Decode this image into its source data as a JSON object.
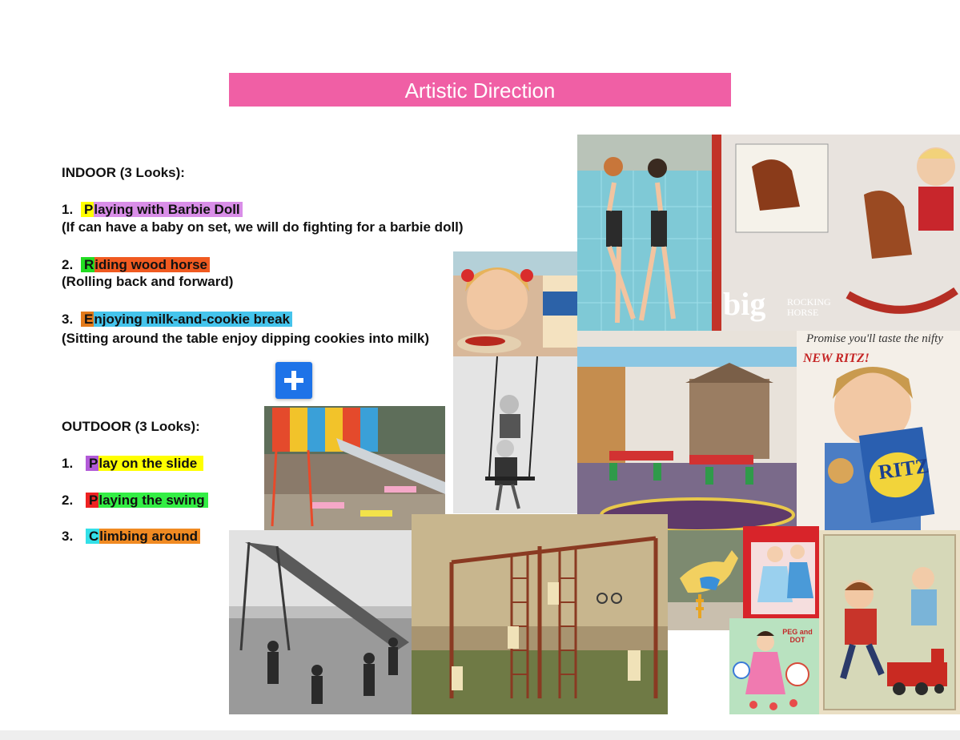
{
  "title": "Artistic Direction",
  "indoor": {
    "heading": "INDOOR (3 Looks):",
    "items": [
      {
        "num": "1.",
        "first": "P",
        "rest": "laying with Barbie Doll",
        "first_color": "#ffff00",
        "rest_color": "#d98ee8",
        "note": "(If can have a baby on set, we will do fighting for a barbie doll)"
      },
      {
        "num": "2.",
        "first": "R",
        "rest": "iding wood horse",
        "first_color": "#22dd22",
        "rest_color": "#f05a20",
        "note": "(Rolling back and forward)"
      },
      {
        "num": "3.",
        "first": "E",
        "rest": "njoying milk-and-cookie break",
        "first_color": "#e37a1a",
        "rest_color": "#45c4ec",
        "note": "(Sitting around the table enjoy dipping cookies into milk)"
      }
    ]
  },
  "outdoor": {
    "heading": "OUTDOOR (3 Looks):",
    "items": [
      {
        "num": "1.",
        "first": "P",
        "rest": "lay on the slide",
        "first_color": "#b25ad8",
        "rest_color": "#ffff00"
      },
      {
        "num": "2.",
        "first": "P",
        "rest": "laying the swing",
        "first_color": "#ee2222",
        "rest_color": "#33ee44"
      },
      {
        "num": "3.",
        "first": "C",
        "rest": "limbing around",
        "first_color": "#33e0e8",
        "rest_color": "#f08a22"
      }
    ]
  },
  "photos": {
    "big_logo": "big",
    "rocking_horse": "ROCKING HORSE",
    "ritz_slogan": "Promise you'll taste the nifty",
    "new_ritz": "NEW RITZ!",
    "ritz": "RITZ",
    "peg_dot": "PEG and DOT"
  },
  "colors": {
    "banner": "#f05fa5",
    "button": "#1e73e8"
  },
  "icons": {
    "add": "plus-icon"
  }
}
